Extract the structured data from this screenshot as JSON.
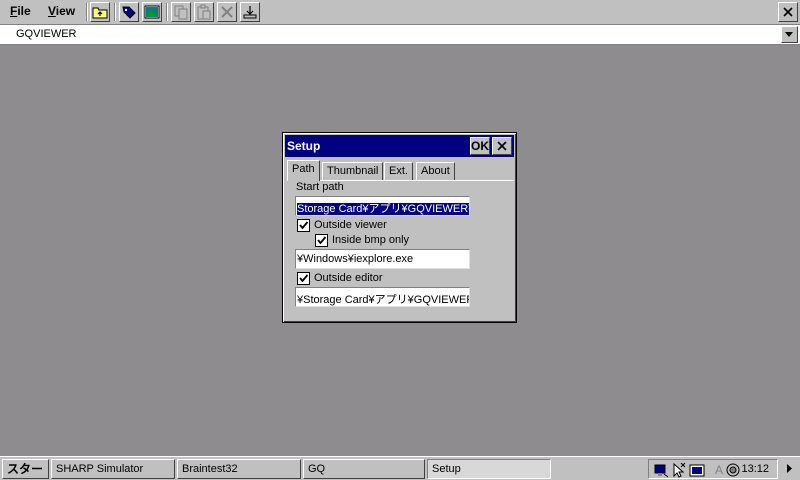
{
  "menubar": {
    "file_label_ul": "F",
    "file_label_rest": "ile",
    "view_label_ul": "V",
    "view_label_rest": "iew",
    "toolbar_icons": [
      "up-folder-icon",
      "tag-icon",
      "image-icon",
      "copy-icon",
      "paste-icon",
      "delete-icon",
      "download-icon"
    ]
  },
  "address": {
    "value": "GQVIEWER"
  },
  "dialog": {
    "title": "Setup",
    "ok_label": "OK",
    "tabs": [
      {
        "label": "Path",
        "active": true
      },
      {
        "label": "Thumbnail",
        "active": false
      },
      {
        "label": "Ext.",
        "active": false
      },
      {
        "label": "About",
        "active": false
      }
    ],
    "start_path_label": "Start path",
    "start_path_value": "Storage Card¥アプリ¥GQVIEWER¥",
    "outside_viewer": {
      "label": "Outside viewer",
      "checked": true
    },
    "inside_bmp_only": {
      "label": "Inside bmp only",
      "checked": true
    },
    "viewer_path_value": "¥Windows¥iexplore.exe",
    "outside_editor": {
      "label": "Outside editor",
      "checked": true
    },
    "editor_path_value": "¥Storage Card¥アプリ¥GQVIEWER¥"
  },
  "taskbar": {
    "start_label": "スタート",
    "tasks": [
      {
        "label": "SHARP Simulator",
        "active": false
      },
      {
        "label": "Braintest32",
        "active": false
      },
      {
        "label": "GQ",
        "active": false
      },
      {
        "label": "Setup",
        "active": true
      }
    ],
    "tray_icons": [
      "network-icon",
      "cursor-icon",
      "keyboard-icon",
      "input-method-icon",
      "sound-icon"
    ],
    "ime_letter": "A",
    "clock": "13:12"
  },
  "colors": {
    "desktop": "#8e8c8e",
    "titlebar": "#000080",
    "selection": "#000080"
  }
}
